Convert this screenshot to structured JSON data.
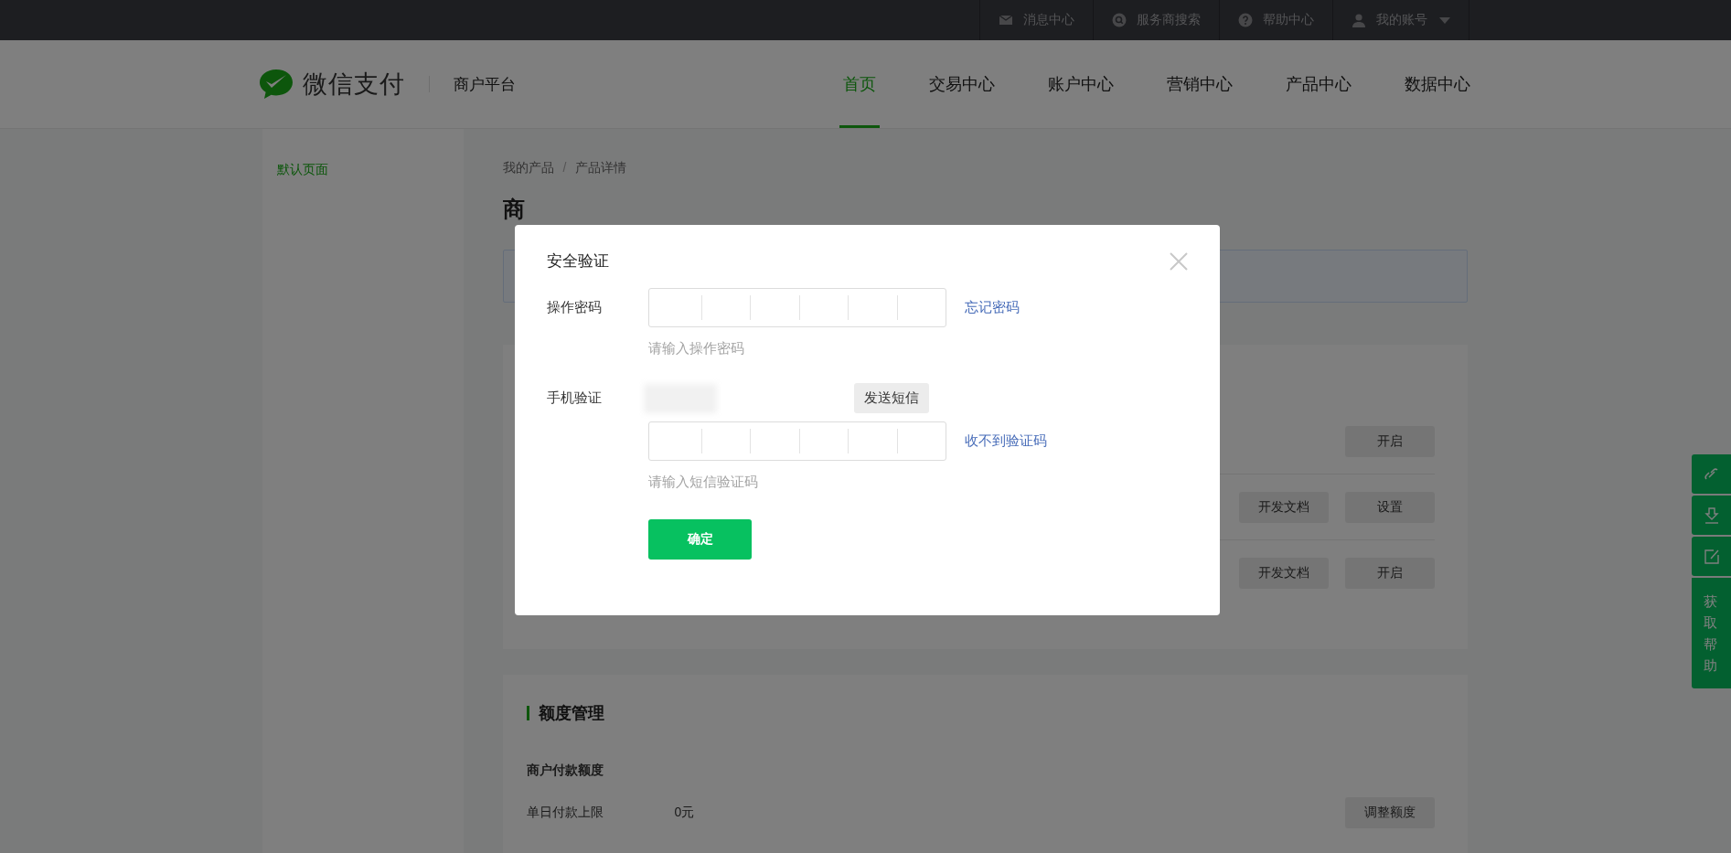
{
  "top_bar": {
    "items": [
      {
        "kind": "mail",
        "label": "消息中心",
        "has_menu": false
      },
      {
        "kind": "search",
        "label": "服务商搜索",
        "has_menu": false
      },
      {
        "kind": "help",
        "label": "帮助中心",
        "has_menu": false
      },
      {
        "kind": "user",
        "label": "我的账号",
        "has_menu": true
      }
    ]
  },
  "header": {
    "brand": "微信支付",
    "platform": "商户平台",
    "nav": [
      {
        "label": "首页",
        "selected": true
      },
      {
        "label": "交易中心",
        "selected": false
      },
      {
        "label": "账户中心",
        "selected": false
      },
      {
        "label": "营销中心",
        "selected": false
      },
      {
        "label": "产品中心",
        "selected": false
      },
      {
        "label": "数据中心",
        "selected": false
      }
    ]
  },
  "sidebar": {
    "items": [
      {
        "label": "默认页面",
        "selected": true
      }
    ]
  },
  "breadcrumb": {
    "items": [
      "我的产品",
      "产品详情"
    ],
    "separator": "/"
  },
  "page_title": "商",
  "products": {
    "rows": [
      {
        "buttons": [
          "开启"
        ]
      },
      {
        "buttons": [
          "开发文档",
          "设置"
        ]
      },
      {
        "buttons": [
          "开发文档",
          "开启"
        ]
      }
    ]
  },
  "quota": {
    "title": "额度管理",
    "subtitle": "商户付款额度",
    "rows": [
      {
        "label": "单日付款上限",
        "value": "0元",
        "button": "调整额度"
      }
    ]
  },
  "float_help": {
    "tools": [
      {
        "kind": "link"
      },
      {
        "kind": "download"
      },
      {
        "kind": "edit"
      }
    ],
    "label": "获取帮助"
  },
  "dialog": {
    "title": "安全验证",
    "fields": [
      {
        "label": "操作密码",
        "hint": "请输入操作密码",
        "link": "忘记密码",
        "phone_redacted": false
      },
      {
        "label": "手机验证",
        "hint": "请输入短信验证码",
        "link": "收不到验证码",
        "phone_redacted": true,
        "send_button": "发送短信"
      }
    ],
    "confirm": "确定"
  }
}
